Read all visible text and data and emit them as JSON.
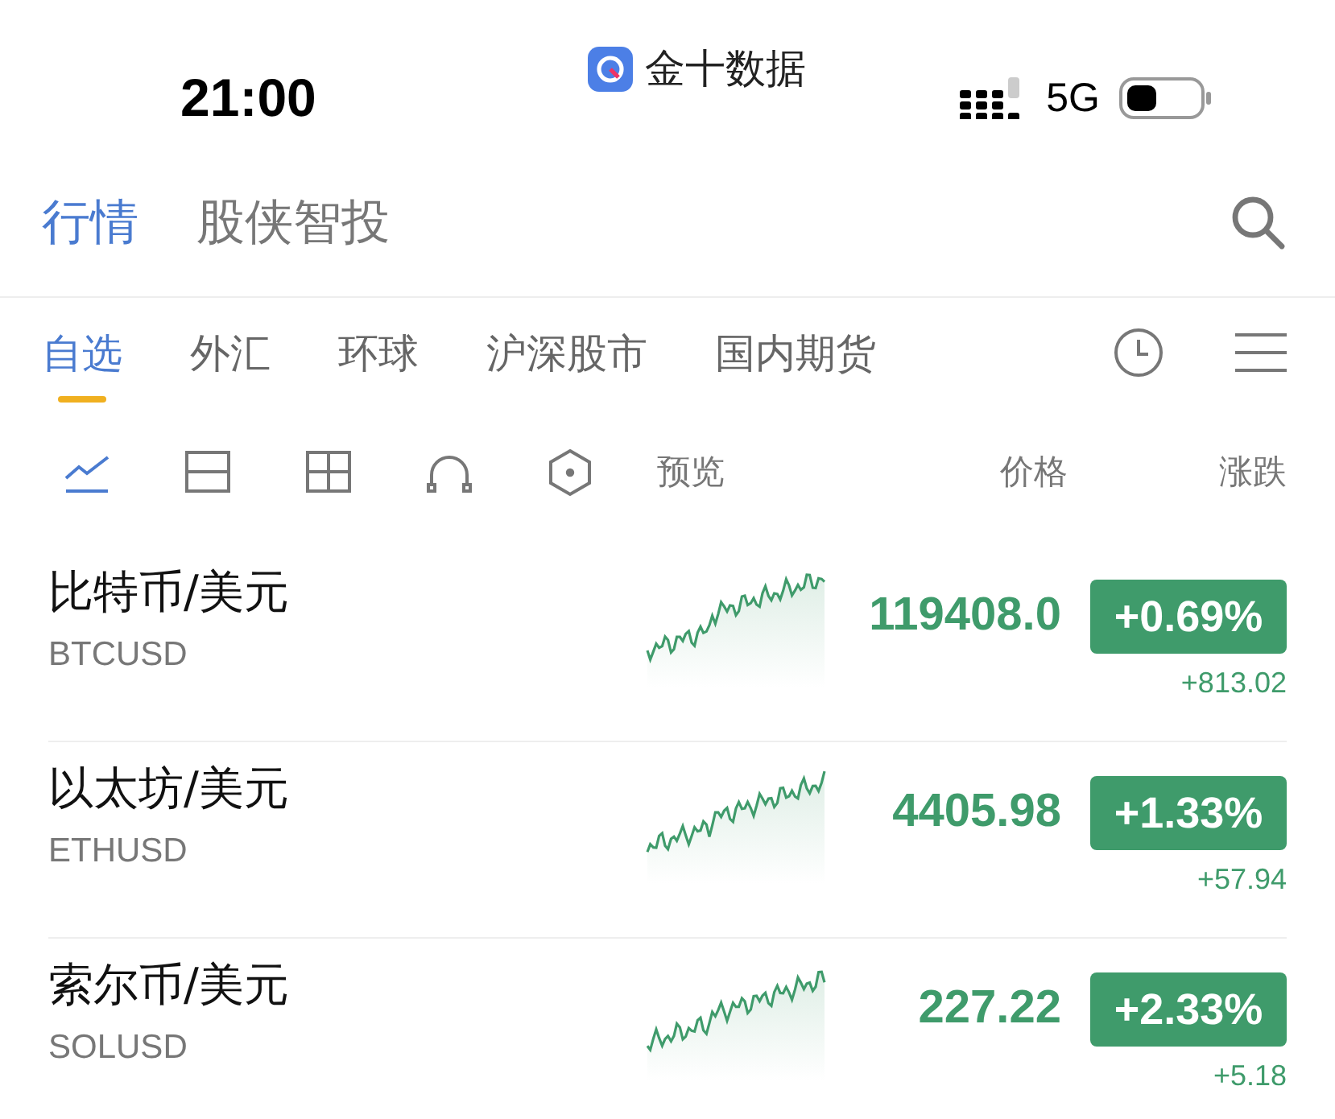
{
  "status_bar": {
    "time": "21:00",
    "app_name": "金十数据",
    "network": "5G"
  },
  "header_tabs": [
    {
      "label": "行情",
      "selected": true
    },
    {
      "label": "股侠智投",
      "selected": false
    }
  ],
  "market_tabs": [
    {
      "label": "自选",
      "selected": true
    },
    {
      "label": "外汇",
      "selected": false
    },
    {
      "label": "环球",
      "selected": false
    },
    {
      "label": "沪深股市",
      "selected": false
    },
    {
      "label": "国内期货",
      "selected": false
    }
  ],
  "view_modes": [
    {
      "kind": "line",
      "selected": true
    },
    {
      "kind": "split",
      "selected": false
    },
    {
      "kind": "grid",
      "selected": false
    },
    {
      "kind": "arch",
      "selected": false
    },
    {
      "kind": "hexagon",
      "selected": false
    }
  ],
  "columns": {
    "preview": "预览",
    "price": "价格",
    "change": "涨跌"
  },
  "rows": [
    {
      "name": "比特币/美元",
      "code": "BTCUSD",
      "price": "119408.0",
      "percent": "+0.69%",
      "change": "+813.02",
      "color": "#3f9b6b"
    },
    {
      "name": "以太坊/美元",
      "code": "ETHUSD",
      "price": "4405.98",
      "percent": "+1.33%",
      "change": "+57.94",
      "color": "#3f9b6b"
    },
    {
      "name": "索尔币/美元",
      "code": "SOLUSD",
      "price": "227.22",
      "percent": "+2.33%",
      "change": "+5.18",
      "color": "#3f9b6b"
    }
  ]
}
